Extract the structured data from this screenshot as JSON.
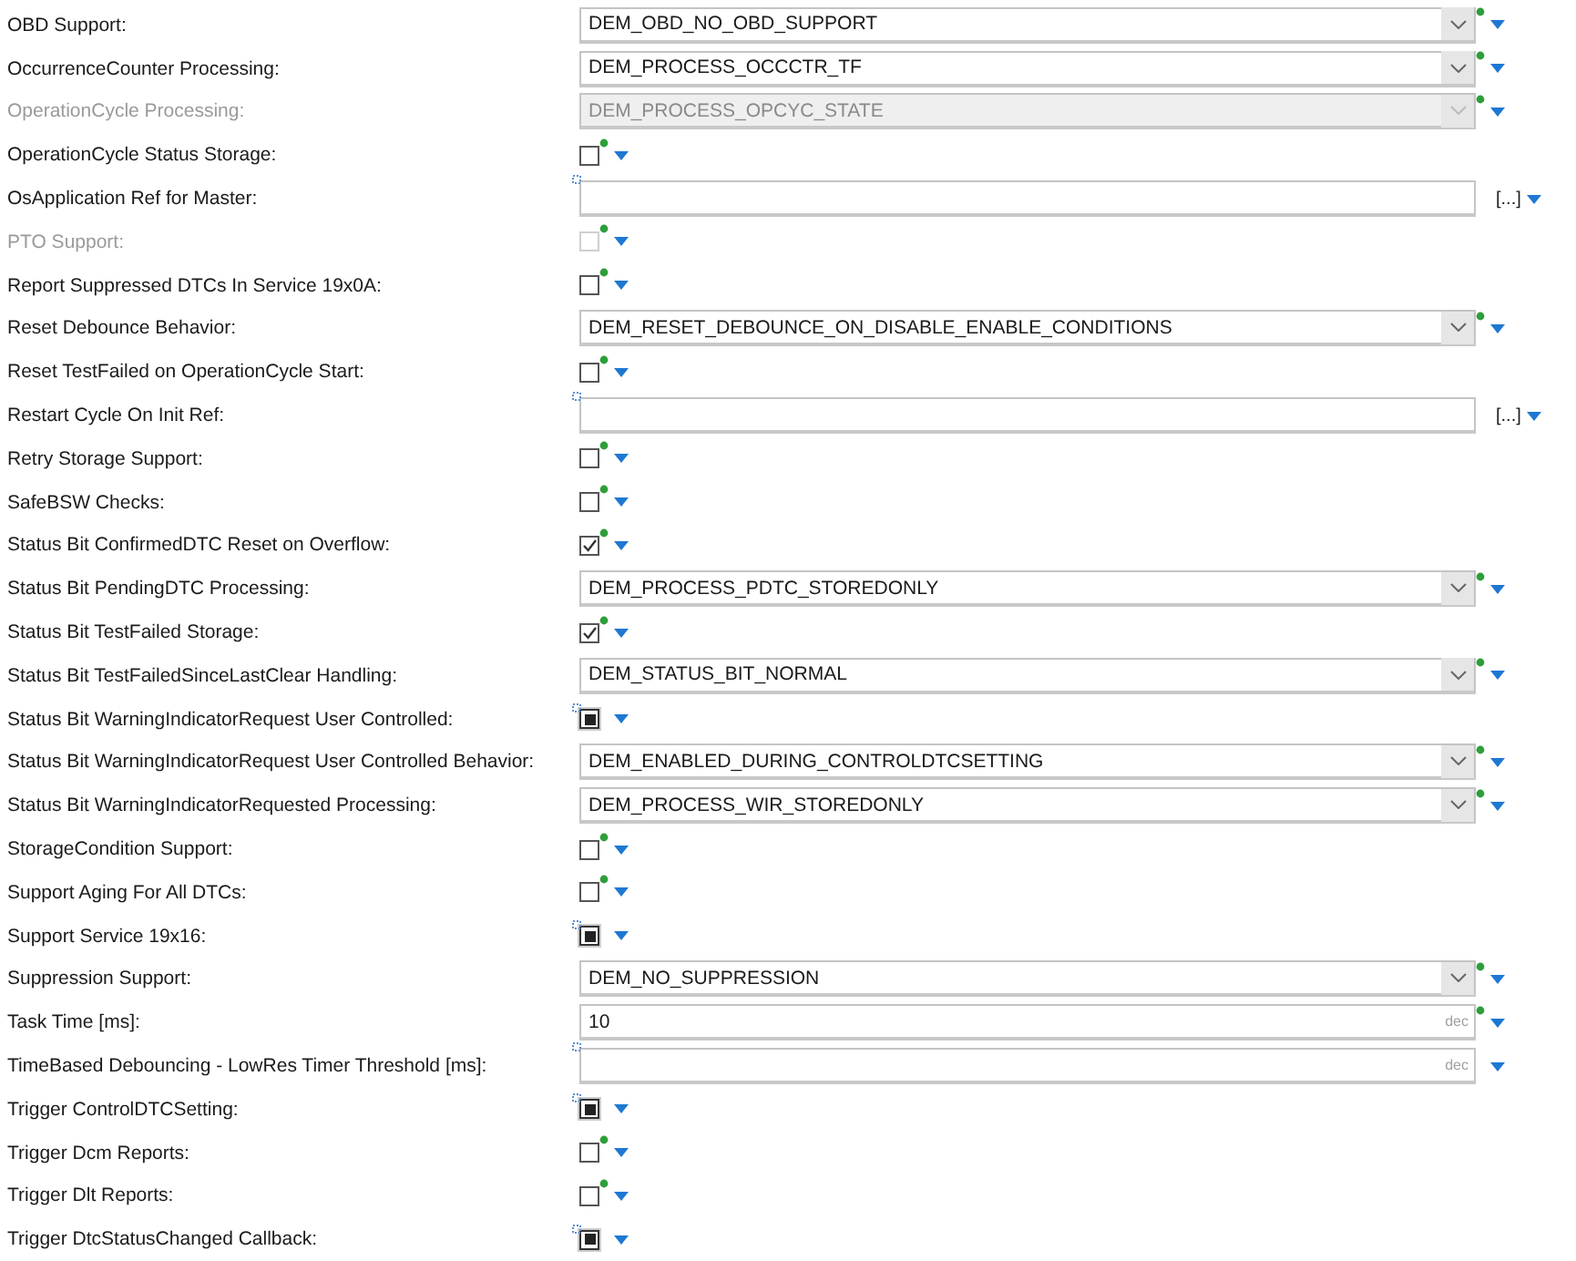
{
  "settings": [
    {
      "label": "OBD Support:",
      "kind": "combo",
      "value": "DEM_OBD_NO_OBD_SUPPORT",
      "disabled": false,
      "modified": true
    },
    {
      "label": "OccurrenceCounter Processing:",
      "kind": "combo",
      "value": "DEM_PROCESS_OCCCTR_TF",
      "disabled": false,
      "modified": true
    },
    {
      "label": "OperationCycle Processing:",
      "kind": "combo",
      "value": "DEM_PROCESS_OPCYC_STATE",
      "disabled": true,
      "modified": true
    },
    {
      "label": "OperationCycle Status Storage:",
      "kind": "checkbox",
      "checked": false,
      "unset": false,
      "disabled": false,
      "modified": true
    },
    {
      "label": "OsApplication Ref for Master:",
      "kind": "reference",
      "unset": true,
      "disabled": false
    },
    {
      "label": "PTO Support:",
      "kind": "checkbox",
      "checked": false,
      "unset": false,
      "disabled": true,
      "modified": true
    },
    {
      "label": "Report Suppressed DTCs In Service 19x0A:",
      "kind": "checkbox",
      "checked": false,
      "unset": false,
      "disabled": false,
      "modified": true
    },
    {
      "label": "Reset Debounce Behavior:",
      "kind": "combo",
      "value": "DEM_RESET_DEBOUNCE_ON_DISABLE_ENABLE_CONDITIONS",
      "disabled": false,
      "modified": true
    },
    {
      "label": "Reset TestFailed on OperationCycle Start:",
      "kind": "checkbox",
      "checked": false,
      "unset": false,
      "disabled": false,
      "modified": true
    },
    {
      "label": "Restart Cycle On Init Ref:",
      "kind": "reference",
      "unset": true,
      "disabled": false
    },
    {
      "label": "Retry Storage Support:",
      "kind": "checkbox",
      "checked": false,
      "unset": false,
      "disabled": false,
      "modified": true
    },
    {
      "label": "SafeBSW Checks:",
      "kind": "checkbox",
      "checked": false,
      "unset": false,
      "disabled": false,
      "modified": true
    },
    {
      "label": "Status Bit ConfirmedDTC Reset on Overflow:",
      "kind": "checkbox",
      "checked": true,
      "unset": false,
      "disabled": false,
      "modified": true
    },
    {
      "label": "Status Bit PendingDTC Processing:",
      "kind": "combo",
      "value": "DEM_PROCESS_PDTC_STOREDONLY",
      "disabled": false,
      "modified": true
    },
    {
      "label": "Status Bit TestFailed Storage:",
      "kind": "checkbox",
      "checked": true,
      "unset": false,
      "disabled": false,
      "modified": true
    },
    {
      "label": "Status Bit TestFailedSinceLastClear Handling:",
      "kind": "combo",
      "value": "DEM_STATUS_BIT_NORMAL",
      "disabled": false,
      "modified": true
    },
    {
      "label": "Status Bit WarningIndicatorRequest User Controlled:",
      "kind": "checkbox",
      "unset": true,
      "disabled": false,
      "modified": false
    },
    {
      "label": "Status Bit WarningIndicatorRequest User Controlled Behavior:",
      "kind": "combo",
      "value": "DEM_ENABLED_DURING_CONTROLDTCSETTING",
      "disabled": false,
      "modified": true
    },
    {
      "label": "Status Bit WarningIndicatorRequested Processing:",
      "kind": "combo",
      "value": "DEM_PROCESS_WIR_STOREDONLY",
      "disabled": false,
      "modified": true
    },
    {
      "label": "StorageCondition Support:",
      "kind": "checkbox",
      "checked": false,
      "unset": false,
      "disabled": false,
      "modified": true
    },
    {
      "label": "Support Aging For All DTCs:",
      "kind": "checkbox",
      "checked": false,
      "unset": false,
      "disabled": false,
      "modified": true
    },
    {
      "label": "Support Service 19x16:",
      "kind": "checkbox",
      "unset": true,
      "disabled": false,
      "modified": false
    },
    {
      "label": "Suppression Support:",
      "kind": "combo",
      "value": "DEM_NO_SUPPRESSION",
      "disabled": false,
      "modified": true
    },
    {
      "label": "Task Time [ms]:",
      "kind": "number",
      "value": "10",
      "unit": "dec",
      "unset": false,
      "disabled": false,
      "modified": true
    },
    {
      "label": "TimeBased Debouncing - LowRes Timer Threshold [ms]:",
      "kind": "number",
      "unit": "dec",
      "unset": true,
      "disabled": false,
      "modified": false
    },
    {
      "label": "Trigger ControlDTCSetting:",
      "kind": "checkbox",
      "unset": true,
      "disabled": false,
      "modified": false
    },
    {
      "label": "Trigger Dcm Reports:",
      "kind": "checkbox",
      "checked": false,
      "unset": false,
      "disabled": false,
      "modified": true
    },
    {
      "label": "Trigger Dlt Reports:",
      "kind": "checkbox",
      "checked": false,
      "unset": false,
      "disabled": false,
      "modified": true
    },
    {
      "label": "Trigger DtcStatusChanged Callback:",
      "kind": "checkbox",
      "unset": true,
      "disabled": false,
      "modified": false
    }
  ],
  "browse_label": "[...]"
}
